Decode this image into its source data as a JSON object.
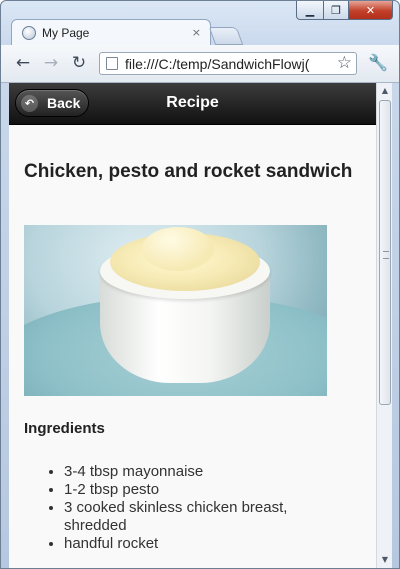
{
  "window": {
    "caption_buttons": {
      "minimize": "▁",
      "maximize": "❐",
      "close": "✕"
    }
  },
  "tab": {
    "title": "My Page",
    "close": "×"
  },
  "toolbar": {
    "back_icon": "←",
    "forward_icon": "→",
    "reload_icon": "↻",
    "url": "file:///C:/temp/SandwichFlowj(",
    "star_icon": "☆",
    "wrench_icon": "🔧"
  },
  "appbar": {
    "back_icon": "↶",
    "back_label": "Back",
    "title": "Recipe"
  },
  "recipe": {
    "title": "Chicken, pesto and rocket sandwich",
    "ingredients_heading": "Ingredients",
    "ingredients": [
      "3-4 tbsp mayonnaise",
      "1-2 tbsp pesto",
      "3 cooked skinless chicken breast, shredded",
      "handful rocket"
    ]
  },
  "scrollbar": {
    "up": "▲",
    "down": "▼"
  }
}
